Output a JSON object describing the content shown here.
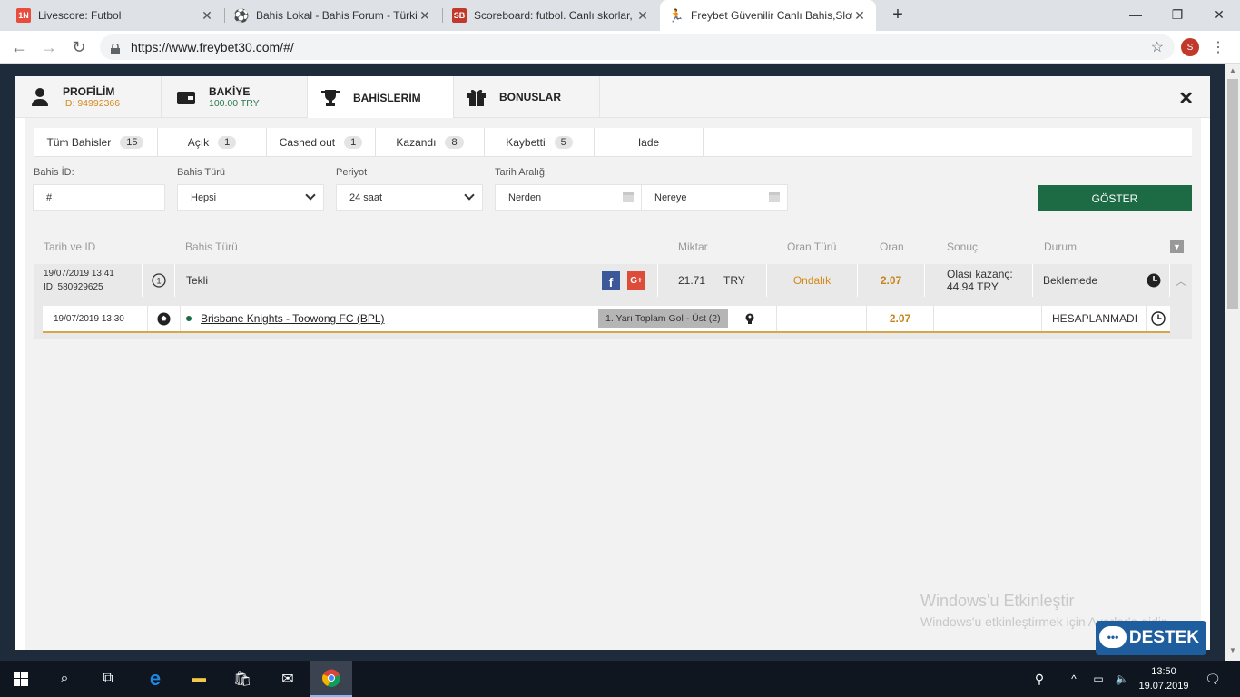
{
  "browser": {
    "tabs": [
      {
        "title": "Livescore: Futbol",
        "icon": "1N-icon"
      },
      {
        "title": "Bahis Lokal - Bahis Forum - Türki",
        "icon": "soccer-ball-icon"
      },
      {
        "title": "Scoreboard: futbol. Canlı skorlar,",
        "icon": "sb-icon"
      },
      {
        "title": "Freybet Güvenilir Canlı Bahis,Slot",
        "icon": "runner-icon"
      }
    ],
    "url": "https://www.freybet30.com/#/",
    "profile_initial": "S"
  },
  "modal": {
    "tabs": {
      "profile": {
        "title": "PROFİLİM",
        "subtitle": "ID: 94992366"
      },
      "balance": {
        "title": "BAKİYE",
        "subtitle": "100.00 TRY"
      },
      "bets": {
        "title": "BAHİSLERİM"
      },
      "bonus": {
        "title": "BONUSLAR"
      }
    },
    "subtabs": [
      {
        "label": "Tüm Bahisler",
        "count": "15"
      },
      {
        "label": "Açık",
        "count": "1"
      },
      {
        "label": "Cashed out",
        "count": "1"
      },
      {
        "label": "Kazandı",
        "count": "8"
      },
      {
        "label": "Kaybetti",
        "count": "5"
      },
      {
        "label": "Iade",
        "count": ""
      }
    ],
    "filters": {
      "bet_id_label": "Bahis İD:",
      "bet_id_value": "#",
      "bet_type_label": "Bahis Türü",
      "bet_type_value": "Hepsi",
      "period_label": "Periyot",
      "period_value": "24 saat",
      "date_range_label": "Tarih Aralığı",
      "date_from": "Nerden",
      "date_to": "Nereye",
      "show_button": "GÖSTER"
    },
    "table": {
      "headers": {
        "date_id": "Tarih ve ID",
        "bet_type": "Bahis Türü",
        "amount": "Miktar",
        "odds_type": "Oran Türü",
        "odds": "Oran",
        "result": "Sonuç",
        "status": "Durum"
      },
      "bet": {
        "date": "19/07/2019 13:41",
        "id": "ID: 580929625",
        "type": "Tekli",
        "amount": "21.71",
        "currency": "TRY",
        "odds_type": "Ondalık",
        "odds": "2.07",
        "result_line1": "Olası kazanç:",
        "result_line2": "44.94 TRY",
        "status": "Beklemede"
      },
      "selection": {
        "date": "19/07/2019 13:30",
        "match": "Brisbane Knights - Toowong FC (BPL)",
        "market": "1. Yarı Toplam Gol - Üst (2)",
        "odds": "2.07",
        "status": "HESAPLANMADI"
      }
    }
  },
  "watermark": {
    "line1": "Windows'u Etkinleştir",
    "line2": "Windows'u etkinleştirmek için Ayarlar'a gidin."
  },
  "support_button": "DESTEK",
  "taskbar": {
    "time": "13:50",
    "date": "19.07.2019"
  }
}
